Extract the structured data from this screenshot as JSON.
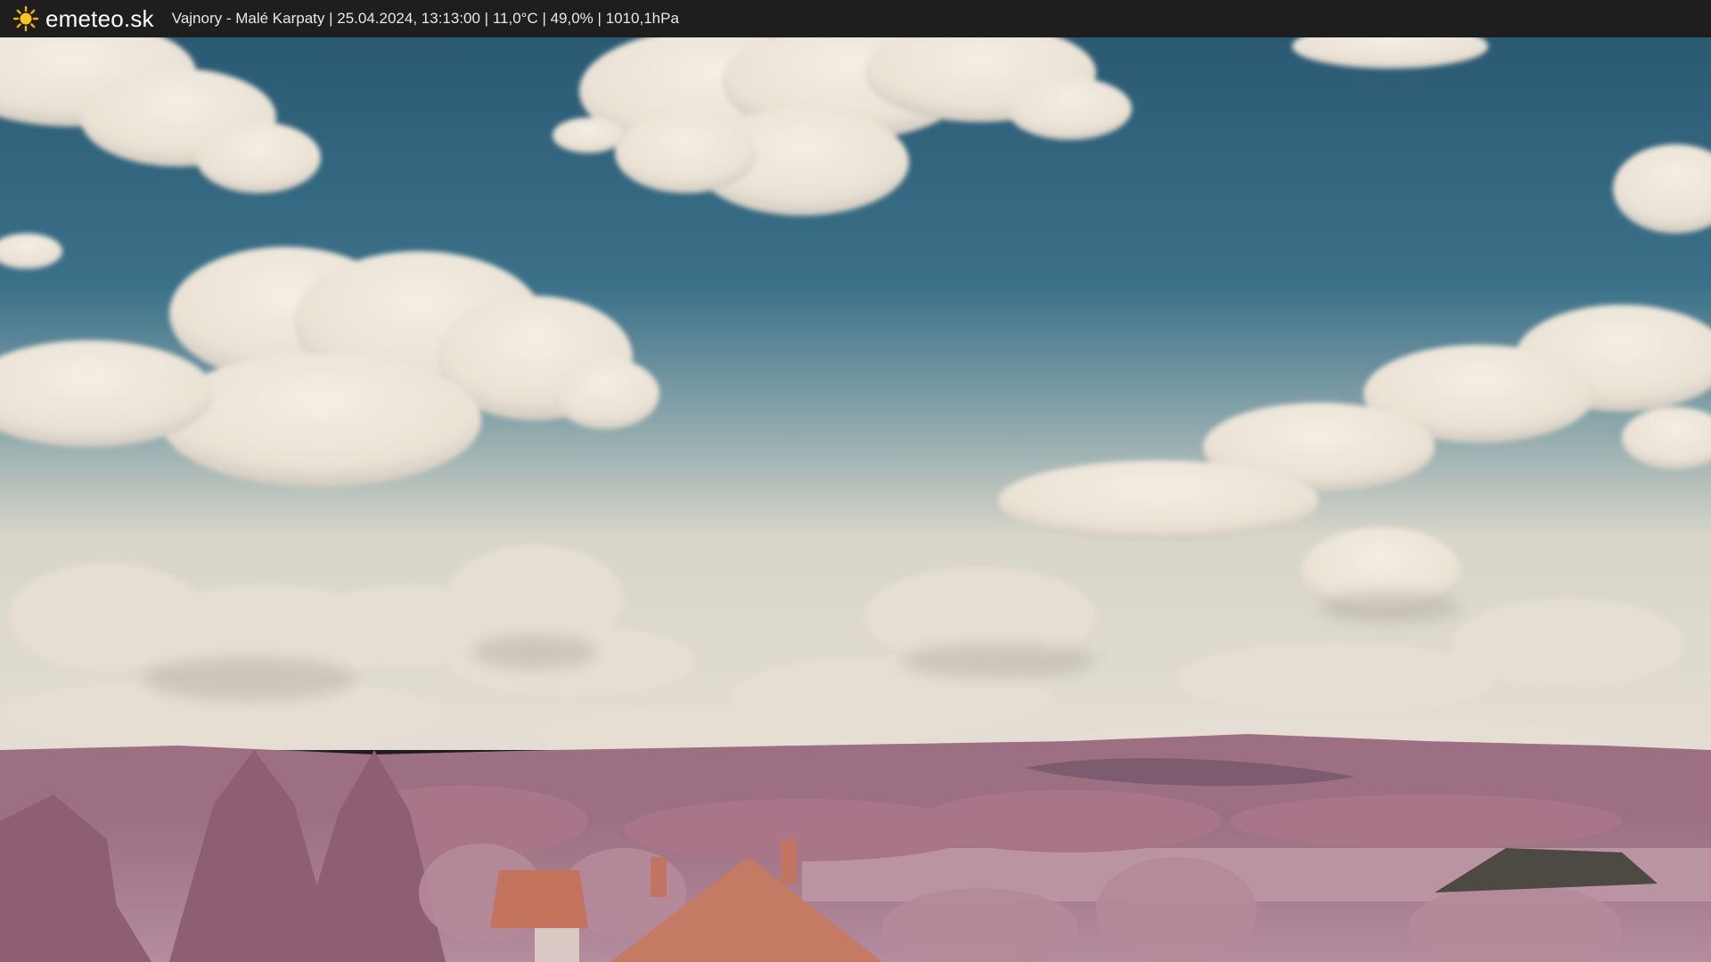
{
  "header": {
    "brand": "emeteo.sk",
    "logo_icon": "sun-icon",
    "info": "Vajnory - Malé Karpaty | 25.04.2024, 13:13:00 | 11,0°C | 49,0% | 1010,1hPa"
  },
  "colors": {
    "sky_top": "#2d5e78",
    "sky_horizon": "#d9d7c8",
    "cloud": "#ece5d8",
    "vegetation": "#a97b8f",
    "roof": "#c4735c",
    "bar_bg": "#1e1e1e",
    "sun_accent": "#f5b400"
  }
}
